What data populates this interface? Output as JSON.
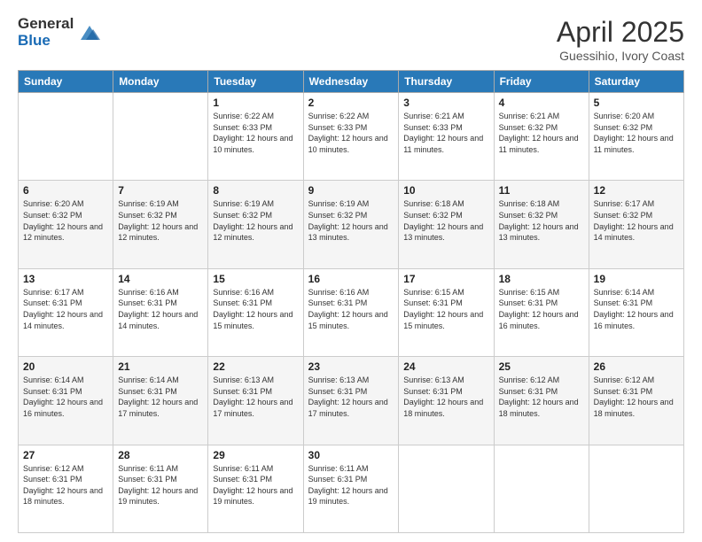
{
  "logo": {
    "general": "General",
    "blue": "Blue"
  },
  "title": {
    "month": "April 2025",
    "location": "Guessihio, Ivory Coast"
  },
  "days_of_week": [
    "Sunday",
    "Monday",
    "Tuesday",
    "Wednesday",
    "Thursday",
    "Friday",
    "Saturday"
  ],
  "weeks": [
    [
      {
        "day": "",
        "sunrise": "",
        "sunset": "",
        "daylight": ""
      },
      {
        "day": "",
        "sunrise": "",
        "sunset": "",
        "daylight": ""
      },
      {
        "day": "1",
        "sunrise": "Sunrise: 6:22 AM",
        "sunset": "Sunset: 6:33 PM",
        "daylight": "Daylight: 12 hours and 10 minutes."
      },
      {
        "day": "2",
        "sunrise": "Sunrise: 6:22 AM",
        "sunset": "Sunset: 6:33 PM",
        "daylight": "Daylight: 12 hours and 10 minutes."
      },
      {
        "day": "3",
        "sunrise": "Sunrise: 6:21 AM",
        "sunset": "Sunset: 6:33 PM",
        "daylight": "Daylight: 12 hours and 11 minutes."
      },
      {
        "day": "4",
        "sunrise": "Sunrise: 6:21 AM",
        "sunset": "Sunset: 6:32 PM",
        "daylight": "Daylight: 12 hours and 11 minutes."
      },
      {
        "day": "5",
        "sunrise": "Sunrise: 6:20 AM",
        "sunset": "Sunset: 6:32 PM",
        "daylight": "Daylight: 12 hours and 11 minutes."
      }
    ],
    [
      {
        "day": "6",
        "sunrise": "Sunrise: 6:20 AM",
        "sunset": "Sunset: 6:32 PM",
        "daylight": "Daylight: 12 hours and 12 minutes."
      },
      {
        "day": "7",
        "sunrise": "Sunrise: 6:19 AM",
        "sunset": "Sunset: 6:32 PM",
        "daylight": "Daylight: 12 hours and 12 minutes."
      },
      {
        "day": "8",
        "sunrise": "Sunrise: 6:19 AM",
        "sunset": "Sunset: 6:32 PM",
        "daylight": "Daylight: 12 hours and 12 minutes."
      },
      {
        "day": "9",
        "sunrise": "Sunrise: 6:19 AM",
        "sunset": "Sunset: 6:32 PM",
        "daylight": "Daylight: 12 hours and 13 minutes."
      },
      {
        "day": "10",
        "sunrise": "Sunrise: 6:18 AM",
        "sunset": "Sunset: 6:32 PM",
        "daylight": "Daylight: 12 hours and 13 minutes."
      },
      {
        "day": "11",
        "sunrise": "Sunrise: 6:18 AM",
        "sunset": "Sunset: 6:32 PM",
        "daylight": "Daylight: 12 hours and 13 minutes."
      },
      {
        "day": "12",
        "sunrise": "Sunrise: 6:17 AM",
        "sunset": "Sunset: 6:32 PM",
        "daylight": "Daylight: 12 hours and 14 minutes."
      }
    ],
    [
      {
        "day": "13",
        "sunrise": "Sunrise: 6:17 AM",
        "sunset": "Sunset: 6:31 PM",
        "daylight": "Daylight: 12 hours and 14 minutes."
      },
      {
        "day": "14",
        "sunrise": "Sunrise: 6:16 AM",
        "sunset": "Sunset: 6:31 PM",
        "daylight": "Daylight: 12 hours and 14 minutes."
      },
      {
        "day": "15",
        "sunrise": "Sunrise: 6:16 AM",
        "sunset": "Sunset: 6:31 PM",
        "daylight": "Daylight: 12 hours and 15 minutes."
      },
      {
        "day": "16",
        "sunrise": "Sunrise: 6:16 AM",
        "sunset": "Sunset: 6:31 PM",
        "daylight": "Daylight: 12 hours and 15 minutes."
      },
      {
        "day": "17",
        "sunrise": "Sunrise: 6:15 AM",
        "sunset": "Sunset: 6:31 PM",
        "daylight": "Daylight: 12 hours and 15 minutes."
      },
      {
        "day": "18",
        "sunrise": "Sunrise: 6:15 AM",
        "sunset": "Sunset: 6:31 PM",
        "daylight": "Daylight: 12 hours and 16 minutes."
      },
      {
        "day": "19",
        "sunrise": "Sunrise: 6:14 AM",
        "sunset": "Sunset: 6:31 PM",
        "daylight": "Daylight: 12 hours and 16 minutes."
      }
    ],
    [
      {
        "day": "20",
        "sunrise": "Sunrise: 6:14 AM",
        "sunset": "Sunset: 6:31 PM",
        "daylight": "Daylight: 12 hours and 16 minutes."
      },
      {
        "day": "21",
        "sunrise": "Sunrise: 6:14 AM",
        "sunset": "Sunset: 6:31 PM",
        "daylight": "Daylight: 12 hours and 17 minutes."
      },
      {
        "day": "22",
        "sunrise": "Sunrise: 6:13 AM",
        "sunset": "Sunset: 6:31 PM",
        "daylight": "Daylight: 12 hours and 17 minutes."
      },
      {
        "day": "23",
        "sunrise": "Sunrise: 6:13 AM",
        "sunset": "Sunset: 6:31 PM",
        "daylight": "Daylight: 12 hours and 17 minutes."
      },
      {
        "day": "24",
        "sunrise": "Sunrise: 6:13 AM",
        "sunset": "Sunset: 6:31 PM",
        "daylight": "Daylight: 12 hours and 18 minutes."
      },
      {
        "day": "25",
        "sunrise": "Sunrise: 6:12 AM",
        "sunset": "Sunset: 6:31 PM",
        "daylight": "Daylight: 12 hours and 18 minutes."
      },
      {
        "day": "26",
        "sunrise": "Sunrise: 6:12 AM",
        "sunset": "Sunset: 6:31 PM",
        "daylight": "Daylight: 12 hours and 18 minutes."
      }
    ],
    [
      {
        "day": "27",
        "sunrise": "Sunrise: 6:12 AM",
        "sunset": "Sunset: 6:31 PM",
        "daylight": "Daylight: 12 hours and 18 minutes."
      },
      {
        "day": "28",
        "sunrise": "Sunrise: 6:11 AM",
        "sunset": "Sunset: 6:31 PM",
        "daylight": "Daylight: 12 hours and 19 minutes."
      },
      {
        "day": "29",
        "sunrise": "Sunrise: 6:11 AM",
        "sunset": "Sunset: 6:31 PM",
        "daylight": "Daylight: 12 hours and 19 minutes."
      },
      {
        "day": "30",
        "sunrise": "Sunrise: 6:11 AM",
        "sunset": "Sunset: 6:31 PM",
        "daylight": "Daylight: 12 hours and 19 minutes."
      },
      {
        "day": "",
        "sunrise": "",
        "sunset": "",
        "daylight": ""
      },
      {
        "day": "",
        "sunrise": "",
        "sunset": "",
        "daylight": ""
      },
      {
        "day": "",
        "sunrise": "",
        "sunset": "",
        "daylight": ""
      }
    ]
  ]
}
